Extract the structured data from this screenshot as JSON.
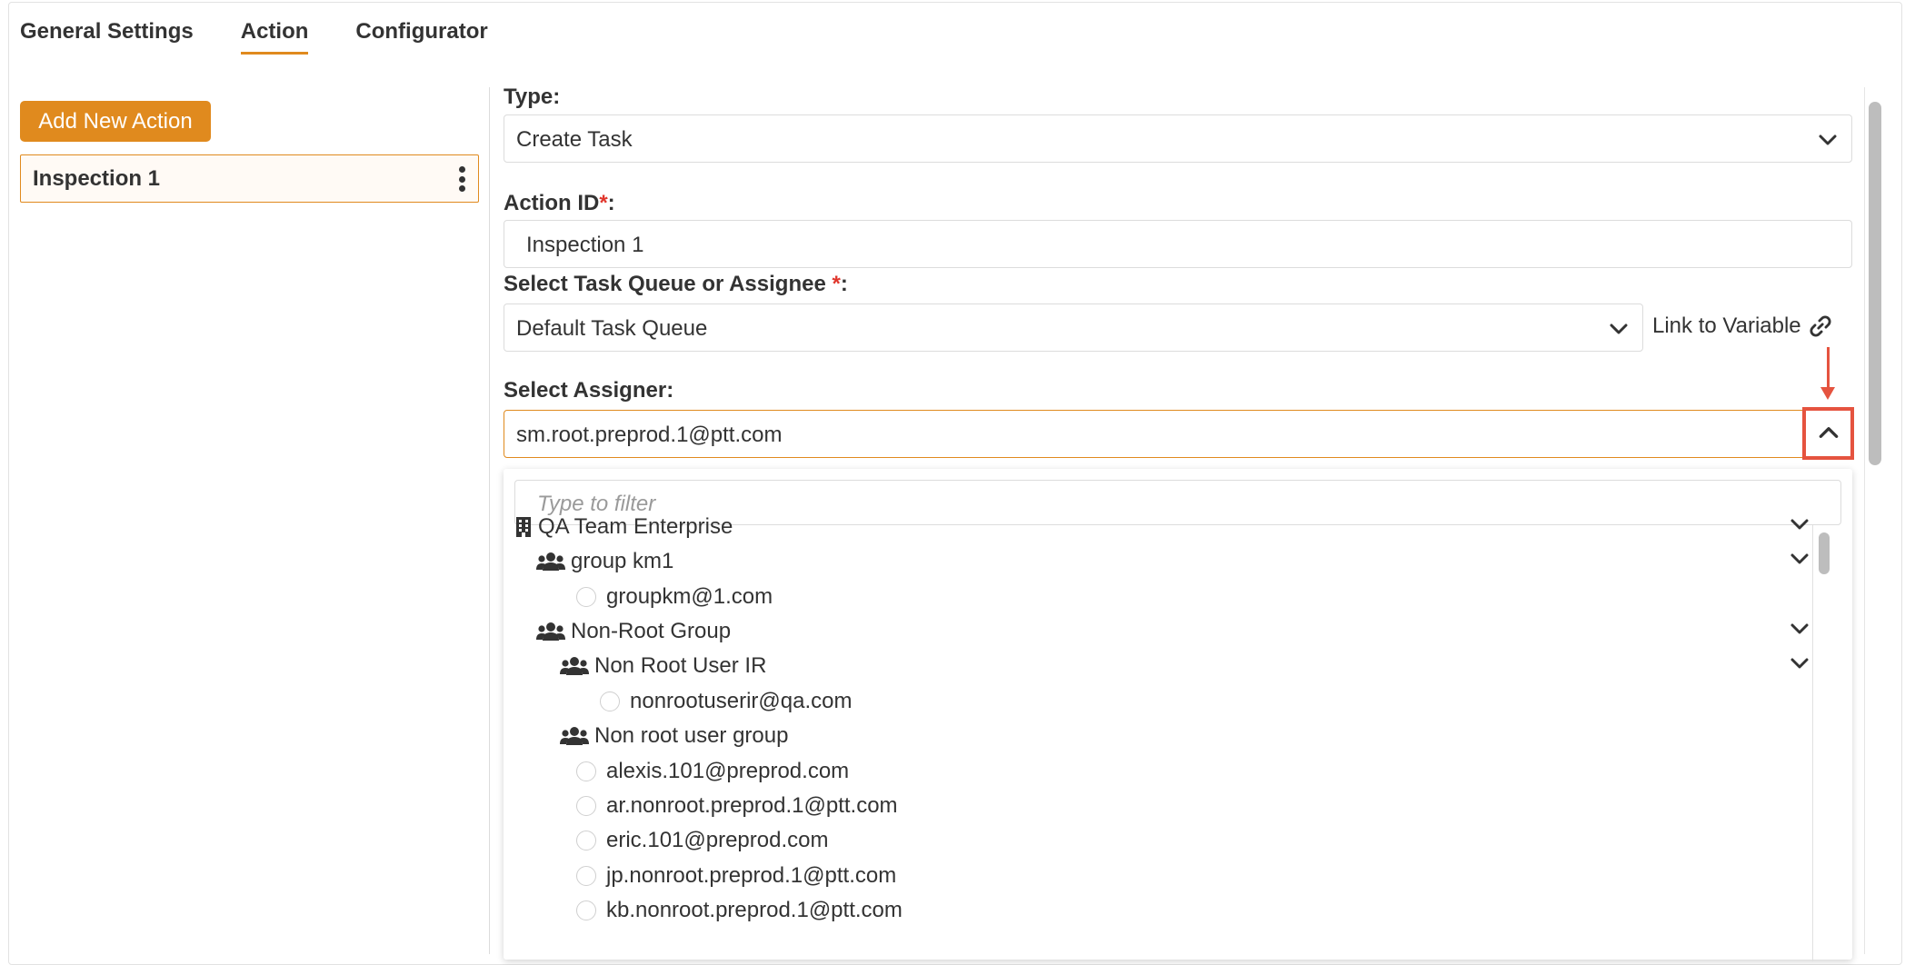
{
  "tabs": [
    {
      "label": "General Settings"
    },
    {
      "label": "Action"
    },
    {
      "label": "Configurator"
    }
  ],
  "active_tab": "Action",
  "left_panel": {
    "add_button_label": "Add New Action",
    "actions": [
      {
        "label": "Inspection 1"
      }
    ]
  },
  "form": {
    "type_label": "Type:",
    "type_value": "Create Task",
    "action_id_label": "Action ID",
    "action_id_value": "Inspection 1",
    "queue_label": "Select Task Queue or Assignee ",
    "queue_value": "Default Task Queue",
    "link_to_variable": "Link to Variable",
    "assigner_label": "Select Assigner:",
    "assigner_value": "sm.root.preprod.1@ptt.com",
    "required_marker": "*",
    "colon": ":"
  },
  "dropdown": {
    "filter_placeholder": "Type to filter",
    "tree": [
      {
        "label": "QA Team Enterprise",
        "kind": "enterprise",
        "level": 0,
        "expandable": true
      },
      {
        "label": "group km1",
        "kind": "group",
        "level": 1,
        "expandable": true
      },
      {
        "label": "groupkm@1.com",
        "kind": "user",
        "level": 2,
        "expandable": false
      },
      {
        "label": "Non-Root Group",
        "kind": "group",
        "level": 1,
        "expandable": true
      },
      {
        "label": "Non Root User IR",
        "kind": "group",
        "level": 2,
        "expandable": true
      },
      {
        "label": "nonrootuserir@qa.com",
        "kind": "user",
        "level": 3,
        "expandable": false
      },
      {
        "label": "Non root user group",
        "kind": "group",
        "level": 2,
        "expandable": false
      },
      {
        "label": "alexis.101@preprod.com",
        "kind": "user",
        "level": 2,
        "expandable": false
      },
      {
        "label": "ar.nonroot.preprod.1@ptt.com",
        "kind": "user",
        "level": 2,
        "expandable": false
      },
      {
        "label": "eric.101@preprod.com",
        "kind": "user",
        "level": 2,
        "expandable": false
      },
      {
        "label": "jp.nonroot.preprod.1@ptt.com",
        "kind": "user",
        "level": 2,
        "expandable": false
      },
      {
        "label": "kb.nonroot.preprod.1@ptt.com",
        "kind": "user",
        "level": 2,
        "expandable": false
      }
    ]
  },
  "colors": {
    "accent": "#e08a1e",
    "required": "#e0362c",
    "highlight": "#e5533f",
    "text": "#333333"
  }
}
